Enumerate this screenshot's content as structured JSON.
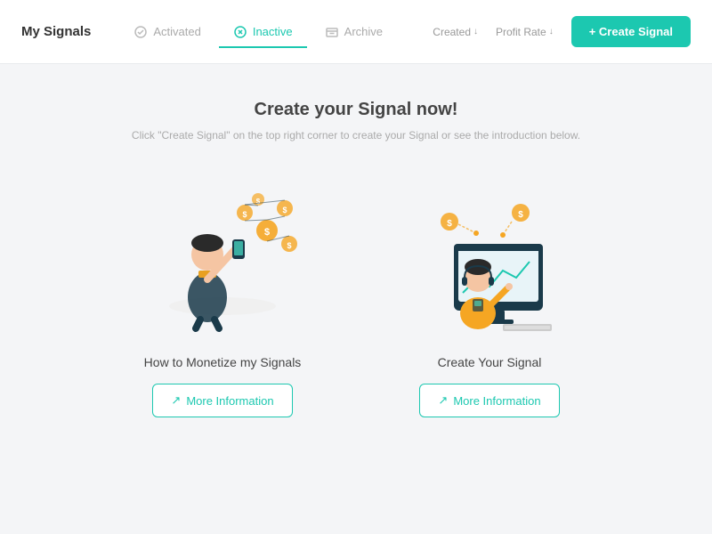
{
  "header": {
    "title": "My Signals",
    "tabs": [
      {
        "label": "Activated",
        "icon": "activity-icon",
        "active": false
      },
      {
        "label": "Inactive",
        "icon": "inactive-icon",
        "active": true
      },
      {
        "label": "Archive",
        "icon": "archive-icon",
        "active": false
      }
    ],
    "sort_labels": [
      {
        "label": "Created",
        "arrow": "↓"
      },
      {
        "label": "Profit Rate",
        "arrow": "↓"
      }
    ],
    "create_button_label": "+ Create Signal"
  },
  "main": {
    "title": "Create your Signal now!",
    "subtitle": "Click \"Create Signal\" on the top right corner to create your Signal or see the introduction below.",
    "cards": [
      {
        "label": "How to Monetize my Signals",
        "button_label": "More Information",
        "illustration": "monetize"
      },
      {
        "label": "Create Your Signal",
        "button_label": "More Information",
        "illustration": "create-signal"
      }
    ]
  }
}
